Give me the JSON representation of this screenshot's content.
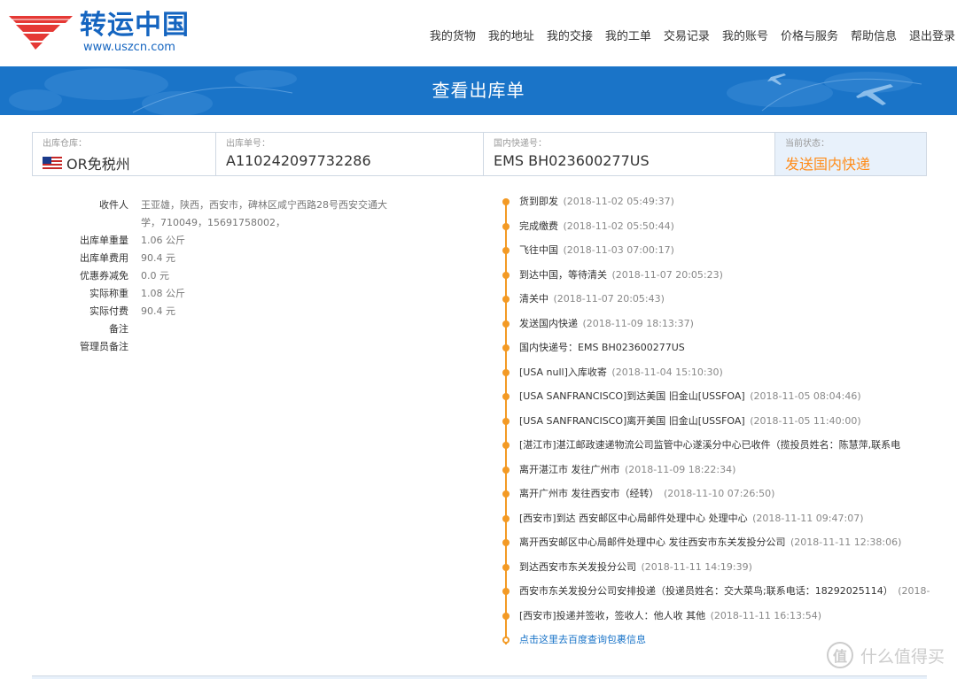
{
  "header": {
    "logo_name": "转运中国",
    "logo_url": "www.uszcn.com",
    "nav": [
      "我的货物",
      "我的地址",
      "我的交接",
      "我的工单",
      "交易记录",
      "我的账号",
      "价格与服务",
      "帮助信息",
      "退出登录"
    ]
  },
  "banner": {
    "title": "查看出库单"
  },
  "info": {
    "warehouse_label": "出库仓库：",
    "warehouse_value": "OR免税州",
    "order_label": "出库单号：",
    "order_value": "A110242097732286",
    "express_label": "国内快递号：",
    "express_value": "EMS BH023600277US",
    "status_label": "当前状态：",
    "status_value": "发送国内快递"
  },
  "details": [
    {
      "label": "收件人",
      "value": "王亚雄，陕西，西安市，碑林区咸宁西路28号西安交通大学，710049，15691758002，"
    },
    {
      "label": "出库单重量",
      "value": "1.06 公斤"
    },
    {
      "label": "出库单费用",
      "value": "90.4 元"
    },
    {
      "label": "优惠券减免",
      "value": "0.0 元"
    },
    {
      "label": "实际称重",
      "value": "1.08 公斤"
    },
    {
      "label": "实际付费",
      "value": "90.4 元"
    },
    {
      "label": "备注",
      "value": ""
    },
    {
      "label": "管理员备注",
      "value": ""
    }
  ],
  "timeline": [
    {
      "text": "货到即发",
      "time": "(2018-11-02 05:49:37)"
    },
    {
      "text": "完成缴费",
      "time": "(2018-11-02 05:50:44)"
    },
    {
      "text": "飞往中国",
      "time": "(2018-11-03 07:00:17)"
    },
    {
      "text": "到达中国，等待清关",
      "time": "(2018-11-07 20:05:23)"
    },
    {
      "text": "清关中",
      "time": "(2018-11-07 20:05:43)"
    },
    {
      "text": "发送国内快递",
      "time": "(2018-11-09 18:13:37)"
    },
    {
      "text": "国内快递号：EMS BH023600277US",
      "time": ""
    },
    {
      "text": "[USA null]入库收寄",
      "time": "(2018-11-04 15:10:30)"
    },
    {
      "text": "[USA SANFRANCISCO]到达美国 旧金山[USSFOA]",
      "time": "(2018-11-05 08:04:46)"
    },
    {
      "text": "[USA SANFRANCISCO]离开美国 旧金山[USSFOA]",
      "time": "(2018-11-05 11:40:00)"
    },
    {
      "text": "[湛江市]湛江邮政速递物流公司监管中心遂溪分中心已收件（揽投员姓名：陈慧萍,联系电",
      "time": ""
    },
    {
      "text": "离开湛江市 发往广州市",
      "time": "(2018-11-09 18:22:34)"
    },
    {
      "text": "离开广州市 发往西安市（经转）",
      "time": "(2018-11-10 07:26:50)"
    },
    {
      "text": "[西安市]到达 西安邮区中心局邮件处理中心 处理中心",
      "time": "(2018-11-11 09:47:07)"
    },
    {
      "text": "离开西安邮区中心局邮件处理中心 发往西安市东关发投分公司",
      "time": "(2018-11-11 12:38:06)"
    },
    {
      "text": "到达西安市东关发投分公司",
      "time": "(2018-11-11 14:19:39)"
    },
    {
      "text": "西安市东关发投分公司安排投递（投递员姓名：交大菜鸟;联系电话：18292025114）",
      "time": "(2018-"
    },
    {
      "text": "[西安市]投递并签收，签收人：他人收 其他",
      "time": "(2018-11-11 16:13:54)"
    }
  ],
  "timeline_link": "点击这里去百度查询包裹信息",
  "watermark": "什么值得买",
  "watermark_icon": "值",
  "colors": {
    "accent": "#f39a25",
    "banner": "#1a74c8",
    "status": "#ff8c1a",
    "link": "#1a74c8"
  }
}
